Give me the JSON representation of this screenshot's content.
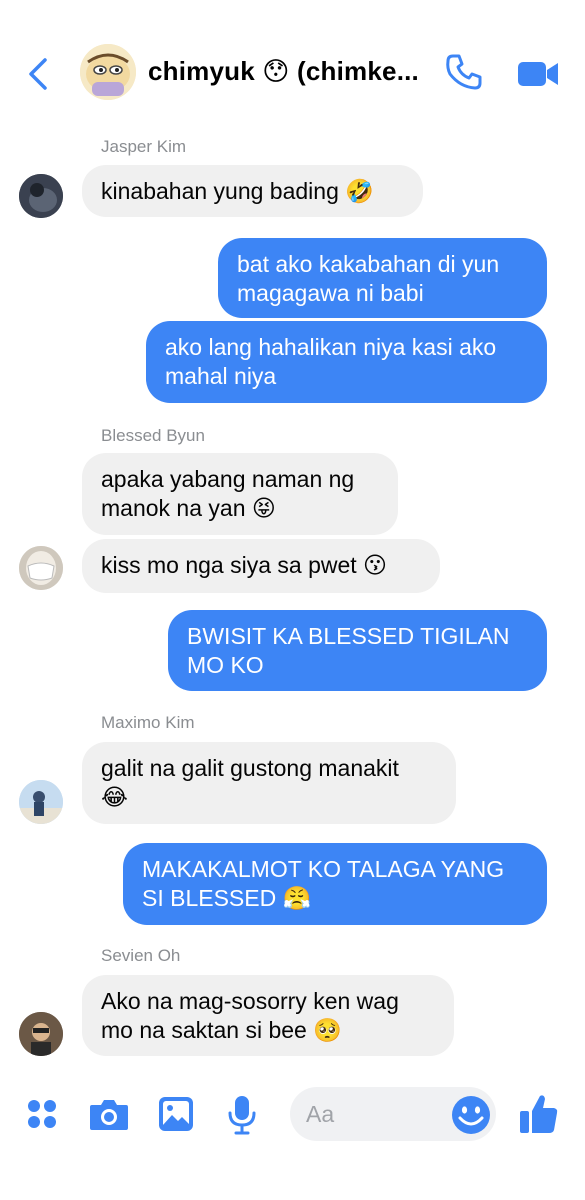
{
  "header": {
    "title": "chimyuk 😯 (chimke...",
    "back_icon": "chevron-left-icon",
    "call_icon": "phone-icon",
    "video_icon": "video-camera-icon"
  },
  "colors": {
    "accent": "#3d85f5",
    "incoming_bubble": "#f0f0f0",
    "sender_name": "#8a8d91"
  },
  "messages": [
    {
      "sender": "Jasper Kim",
      "direction": "in",
      "lines": [
        "kinabahan yung bading 🤣"
      ]
    },
    {
      "direction": "out",
      "lines": [
        "bat ako kakabahan di yun",
        "magagawa ni babi"
      ]
    },
    {
      "direction": "out",
      "lines": [
        "ako lang hahalikan niya kasi ako",
        "mahal niya"
      ]
    },
    {
      "sender": "Blessed Byun",
      "direction": "in",
      "lines": [
        "apaka yabang naman ng",
        "manok na yan 😝"
      ]
    },
    {
      "direction": "in",
      "lines": [
        "kiss mo nga siya sa pwet 😗"
      ]
    },
    {
      "direction": "out",
      "lines": [
        "BWISIT KA BLESSED TIGILAN",
        "MO KO"
      ]
    },
    {
      "sender": "Maximo Kim",
      "direction": "in",
      "lines": [
        "galit na galit gustong manakit",
        "😂"
      ]
    },
    {
      "direction": "out",
      "lines": [
        "MAKAKALMOT KO TALAGA YANG",
        "SI BLESSED 😤"
      ]
    },
    {
      "sender": "Sevien Oh",
      "direction": "in",
      "lines": [
        "Ako na mag-sosorry ken wag",
        "mo na saktan si bee 🥺"
      ]
    }
  ],
  "composer": {
    "placeholder": "Aa",
    "icons": [
      "grid-menu-icon",
      "camera-icon",
      "image-icon",
      "microphone-icon",
      "emoji-icon",
      "thumbs-up-icon"
    ]
  }
}
